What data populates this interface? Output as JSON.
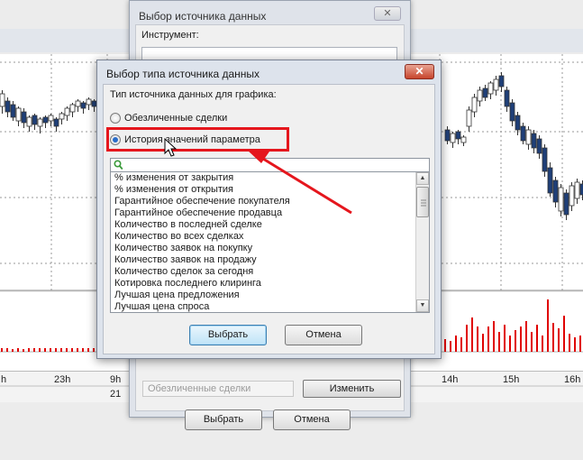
{
  "colors": {
    "accent_red": "#e5161d",
    "candle_blue": "#1f3f78",
    "volume_red": "#e00000",
    "primary_button": "#bfe3f7"
  },
  "background_chart": {
    "time_labels": [
      "h",
      "23h",
      "9h",
      "14h",
      "15h",
      "16h"
    ],
    "date_label": "21"
  },
  "back_dialog": {
    "title": "Выбор источника данных",
    "close_label": "✕",
    "instrument_label": "Инструмент:",
    "disabled_field": "Обезличенные сделки",
    "change_button": "Изменить",
    "select_button": "Выбрать",
    "cancel_button": "Отмена"
  },
  "dialog": {
    "title": "Выбор типа источника данных",
    "close_label": "✕",
    "group_label": "Тип источника данных для графика:",
    "radio_options": [
      {
        "label": "Обезличенные сделки",
        "checked": false
      },
      {
        "label": "История значений параметра",
        "checked": true
      }
    ],
    "search_icon": "search-icon",
    "list_items": [
      "% изменения от закрытия",
      "% изменения от открытия",
      "Гарантийное обеспечение покупателя",
      "Гарантийное обеспечение продавца",
      "Количество в последней сделке",
      "Количество во всех сделках",
      "Количество заявок на покупку",
      "Количество заявок на продажу",
      "Количество сделок за сегодня",
      "Котировка последнего клиринга",
      "Лучшая цена предложения",
      "Лучшая цена спроса"
    ],
    "select_button": "Выбрать",
    "cancel_button": "Отмена"
  }
}
